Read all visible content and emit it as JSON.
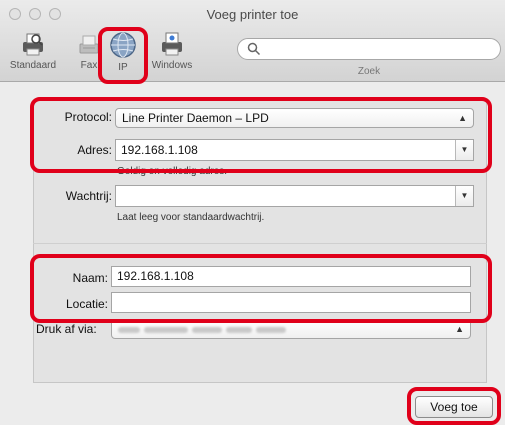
{
  "window": {
    "title": "Voeg printer toe"
  },
  "toolbar": {
    "items": [
      {
        "label": "Standaard",
        "icon": "default-printer-icon"
      },
      {
        "label": "Fax",
        "icon": "fax-icon"
      },
      {
        "label": "IP",
        "icon": "ip-globe-icon",
        "selected": true
      },
      {
        "label": "Windows",
        "icon": "windows-printer-icon"
      }
    ],
    "search": {
      "placeholder": "",
      "label": "Zoek"
    }
  },
  "form": {
    "protocol": {
      "label": "Protocol:",
      "value": "Line Printer Daemon – LPD"
    },
    "adres": {
      "label": "Adres:",
      "value": "192.168.1.108"
    },
    "adres_hint": "Geldig en volledig adres.",
    "wachtrij": {
      "label": "Wachtrij:",
      "value": ""
    },
    "wachtrij_hint": "Laat leeg voor standaardwachtrij.",
    "naam": {
      "label": "Naam:",
      "value": "192.168.1.108"
    },
    "locatie": {
      "label": "Locatie:",
      "value": ""
    },
    "druk_af_via": {
      "label": "Druk af via:",
      "value": ""
    }
  },
  "footer": {
    "add_button": "Voeg toe"
  },
  "colors": {
    "highlight": "#e0001a",
    "window_bg": "#ececec"
  }
}
